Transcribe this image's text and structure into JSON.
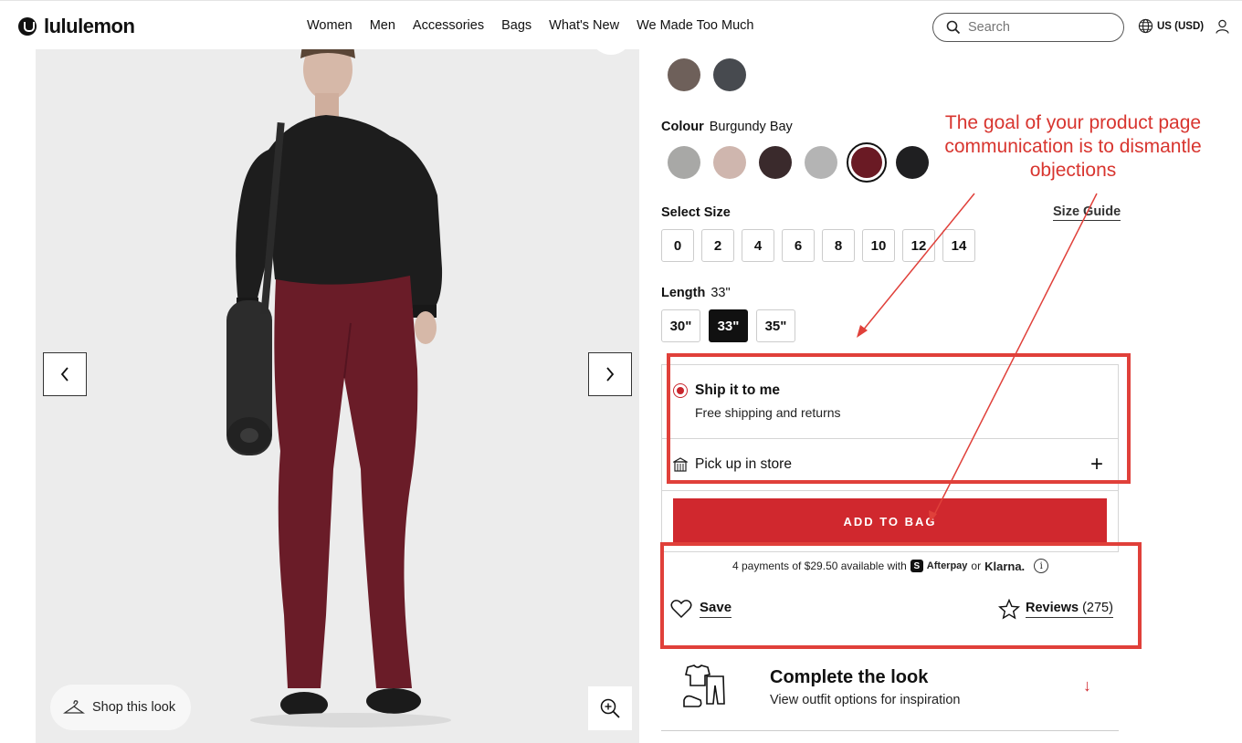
{
  "header": {
    "brand": "lululemon",
    "nav": [
      "Women",
      "Men",
      "Accessories",
      "Bags",
      "What's New",
      "We Made Too Much"
    ],
    "search_placeholder": "Search",
    "locale": "US (USD)"
  },
  "gallery": {
    "shop_look_label": "Shop this look"
  },
  "product": {
    "colour_label": "Colour",
    "colour_value": "Burgundy Bay",
    "top_swatches": [
      "#6e605a",
      "#474a4f"
    ],
    "swatches": [
      "#a8a8a6",
      "#cfb6ae",
      "#3a2a2c",
      "#b4b4b4",
      "#6a1a24",
      "#1f1f21"
    ],
    "selected_swatch_index": 4,
    "size_label": "Select Size",
    "size_guide": "Size Guide",
    "sizes": [
      "0",
      "2",
      "4",
      "6",
      "8",
      "10",
      "12",
      "14"
    ],
    "length_label": "Length",
    "length_value": "33\"",
    "lengths": [
      "30\"",
      "33\"",
      "35\""
    ],
    "selected_length_index": 1,
    "ship_title": "Ship it to me",
    "ship_sub": "Free shipping and returns",
    "pickup": "Pick up in store",
    "add_to_bag": "ADD TO BAG",
    "payments_text": "4 payments of $29.50 available with",
    "afterpay": "Afterpay",
    "or": "or",
    "klarna": "Klarna.",
    "save": "Save",
    "reviews": "Reviews",
    "reviews_count": "(275)",
    "look_title": "Complete the look",
    "look_sub": "View outfit options for inspiration"
  },
  "annotation": {
    "text": "The goal of your product page communication is to dismantle objections",
    "color": "#d8352f"
  },
  "colors": {
    "accent_red": "#d0282e"
  }
}
